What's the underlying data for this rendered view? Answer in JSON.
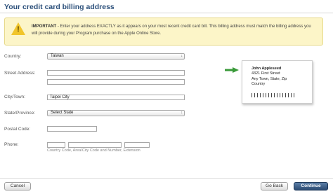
{
  "header": {
    "title": "Your credit card billing address"
  },
  "notice": {
    "icon": "warning-icon",
    "bold": "IMPORTANT",
    "line1_rest": " - Enter your address EXACTLY as it appears on your most recent credit card bill. This billing address must match the billing address you",
    "line2": "will provide during your Program purchase on the Apple Online Store."
  },
  "form": {
    "country": {
      "label": "Country:",
      "value": "Taiwan"
    },
    "street": {
      "label": "Street Address:",
      "line1": "",
      "line2": ""
    },
    "city": {
      "label": "City/Town:",
      "value": "Taipei City"
    },
    "state": {
      "label": "State/Province:",
      "value": "Select State"
    },
    "postal": {
      "label": "Postal Code:",
      "value": ""
    },
    "phone": {
      "label": "Phone:",
      "country_code": "",
      "area_number": "",
      "extension": "",
      "helper": "Country Code, Area/City Code and Number, Extension"
    }
  },
  "example_address": {
    "name": "John Appleseed",
    "street": "4321 First Street",
    "city_line": "Any Town, State, Zip",
    "country": "Country"
  },
  "buttons": {
    "cancel": "Cancel",
    "back": "Go Back",
    "continue": "Continue"
  },
  "colors": {
    "accent": "#2c4b72",
    "notice_bg": "#fcf5c8",
    "arrow": "#3a9a3a"
  }
}
